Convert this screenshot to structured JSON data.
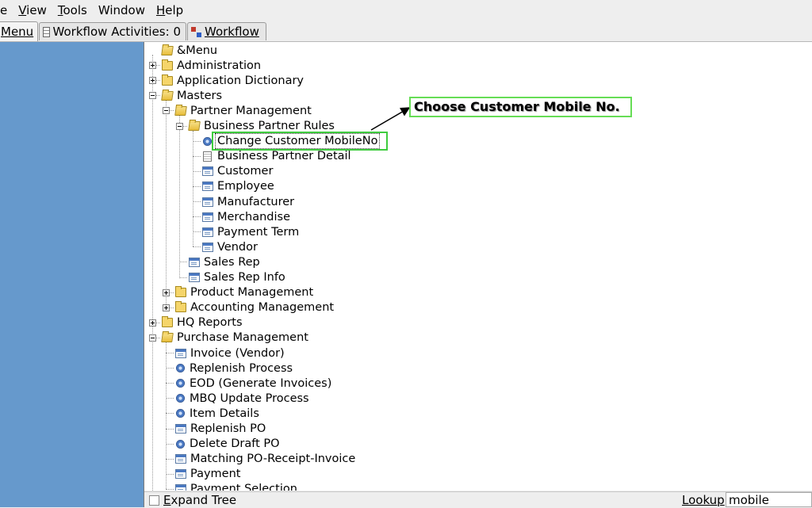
{
  "menubar": {
    "items": [
      {
        "label": "e",
        "mnemonic": ""
      },
      {
        "label": "View",
        "mnemonic": "V"
      },
      {
        "label": "Tools",
        "mnemonic": "T"
      },
      {
        "label": "Window",
        "mnemonic": ""
      },
      {
        "label": "Help",
        "mnemonic": "H"
      }
    ]
  },
  "tabs": {
    "menu": "Menu",
    "workflow_activities": "Workflow Activities: 0",
    "workflow": "Workflow"
  },
  "tree": {
    "nodes": [
      {
        "label": "&Menu",
        "depth": 0,
        "kind": "folder-open",
        "toggle": "none"
      },
      {
        "label": "Administration",
        "depth": 0,
        "kind": "folder",
        "toggle": "plus"
      },
      {
        "label": "Application Dictionary",
        "depth": 0,
        "kind": "folder",
        "toggle": "plus"
      },
      {
        "label": "Masters",
        "depth": 0,
        "kind": "folder-open",
        "toggle": "minus"
      },
      {
        "label": "Partner Management",
        "depth": 1,
        "kind": "folder-open",
        "toggle": "minus"
      },
      {
        "label": "Business Partner Rules",
        "depth": 2,
        "kind": "folder-open",
        "toggle": "minus"
      },
      {
        "label": "Change Customer MobileNo",
        "depth": 3,
        "kind": "process",
        "toggle": "none",
        "selected": true
      },
      {
        "label": "Business Partner Detail",
        "depth": 3,
        "kind": "document",
        "toggle": "none"
      },
      {
        "label": "Customer",
        "depth": 3,
        "kind": "window",
        "toggle": "none"
      },
      {
        "label": "Employee",
        "depth": 3,
        "kind": "window",
        "toggle": "none"
      },
      {
        "label": "Manufacturer",
        "depth": 3,
        "kind": "window",
        "toggle": "none"
      },
      {
        "label": "Merchandise",
        "depth": 3,
        "kind": "window",
        "toggle": "none"
      },
      {
        "label": "Payment Term",
        "depth": 3,
        "kind": "window",
        "toggle": "none"
      },
      {
        "label": "Vendor",
        "depth": 3,
        "kind": "window",
        "toggle": "none"
      },
      {
        "label": "Sales Rep",
        "depth": 2,
        "kind": "window",
        "toggle": "none"
      },
      {
        "label": "Sales Rep Info",
        "depth": 2,
        "kind": "window",
        "toggle": "none"
      },
      {
        "label": "Product Management",
        "depth": 1,
        "kind": "folder",
        "toggle": "plus"
      },
      {
        "label": "Accounting Management",
        "depth": 1,
        "kind": "folder",
        "toggle": "plus"
      },
      {
        "label": "HQ Reports",
        "depth": 0,
        "kind": "folder",
        "toggle": "plus"
      },
      {
        "label": "Purchase Management",
        "depth": 0,
        "kind": "folder-open",
        "toggle": "minus"
      },
      {
        "label": "Invoice (Vendor)",
        "depth": 1,
        "kind": "window",
        "toggle": "none"
      },
      {
        "label": "Replenish Process",
        "depth": 1,
        "kind": "process",
        "toggle": "none"
      },
      {
        "label": "EOD (Generate Invoices)",
        "depth": 1,
        "kind": "process",
        "toggle": "none"
      },
      {
        "label": "MBQ Update Process",
        "depth": 1,
        "kind": "process",
        "toggle": "none"
      },
      {
        "label": "Item Details",
        "depth": 1,
        "kind": "process",
        "toggle": "none"
      },
      {
        "label": "Replenish PO",
        "depth": 1,
        "kind": "window",
        "toggle": "none"
      },
      {
        "label": "Delete Draft PO",
        "depth": 1,
        "kind": "process",
        "toggle": "none"
      },
      {
        "label": "Matching PO-Receipt-Invoice",
        "depth": 1,
        "kind": "window",
        "toggle": "none"
      },
      {
        "label": "Payment",
        "depth": 1,
        "kind": "window",
        "toggle": "none"
      },
      {
        "label": "Payment Selection",
        "depth": 1,
        "kind": "window",
        "toggle": "none"
      }
    ]
  },
  "annotation": {
    "callout_text": "Choose Customer Mobile No.",
    "highlight_color": "#3fcc3f"
  },
  "bottom": {
    "expand_tree_label": "Expand Tree",
    "expand_tree_mnemonic": "E",
    "lookup_label": "Lookup",
    "lookup_value": "mobile"
  },
  "colors": {
    "left_panel": "#6699cc",
    "window_bg": "#eeeeee"
  }
}
